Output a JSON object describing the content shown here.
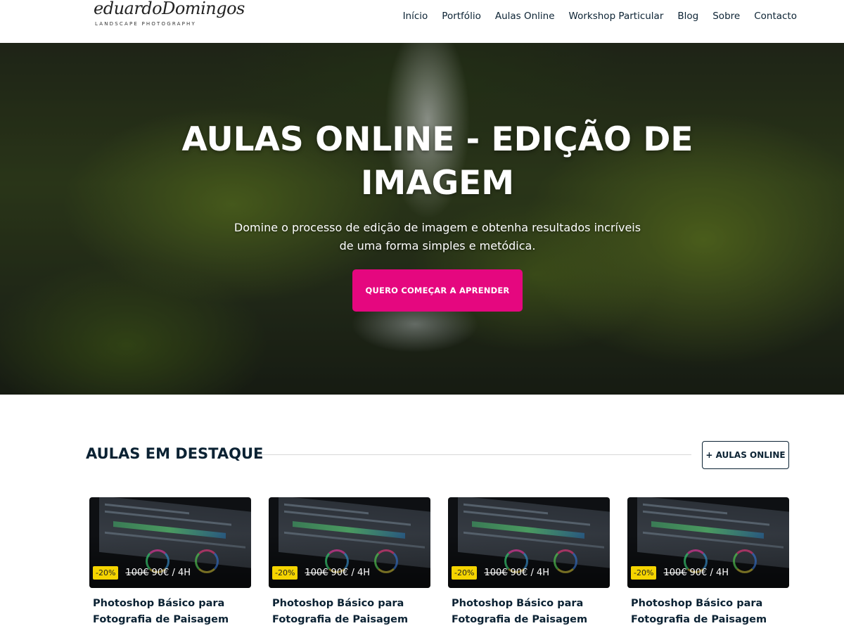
{
  "header": {
    "logo_script": "eduardoDomingos",
    "logo_sub": "LANDSCAPE PHOTOGRAPHY",
    "nav": [
      "Início",
      "Portfólio",
      "Aulas Online",
      "Workshop Particular",
      "Blog",
      "Sobre",
      "Contacto"
    ]
  },
  "hero": {
    "title": "AULAS ONLINE - EDIÇÃO DE IMAGEM",
    "subtitle": "Domine o processo de edição de imagem e obtenha resultados incríveis de uma forma simples e metódica.",
    "button": "QUERO COMEÇAR A APRENDER",
    "accent_color": "#e5077f"
  },
  "featured": {
    "title": "AULAS EM DESTAQUE",
    "more_button": "+ AULAS ONLINE",
    "cards": [
      {
        "badge": "-20%",
        "old_price": "100€",
        "price": "90€ / 4H",
        "title": "Photoshop Básico para Fotografia de Paisagem"
      },
      {
        "badge": "-20%",
        "old_price": "100€",
        "price": "90€ / 4H",
        "title": "Photoshop Básico para Fotografia de Paisagem"
      },
      {
        "badge": "-20%",
        "old_price": "100€",
        "price": "90€ / 4H",
        "title": "Photoshop Básico para Fotografia de Paisagem"
      },
      {
        "badge": "-20%",
        "old_price": "100€",
        "price": "90€ / 4H",
        "title": "Photoshop Básico para Fotografia de Paisagem"
      }
    ]
  }
}
